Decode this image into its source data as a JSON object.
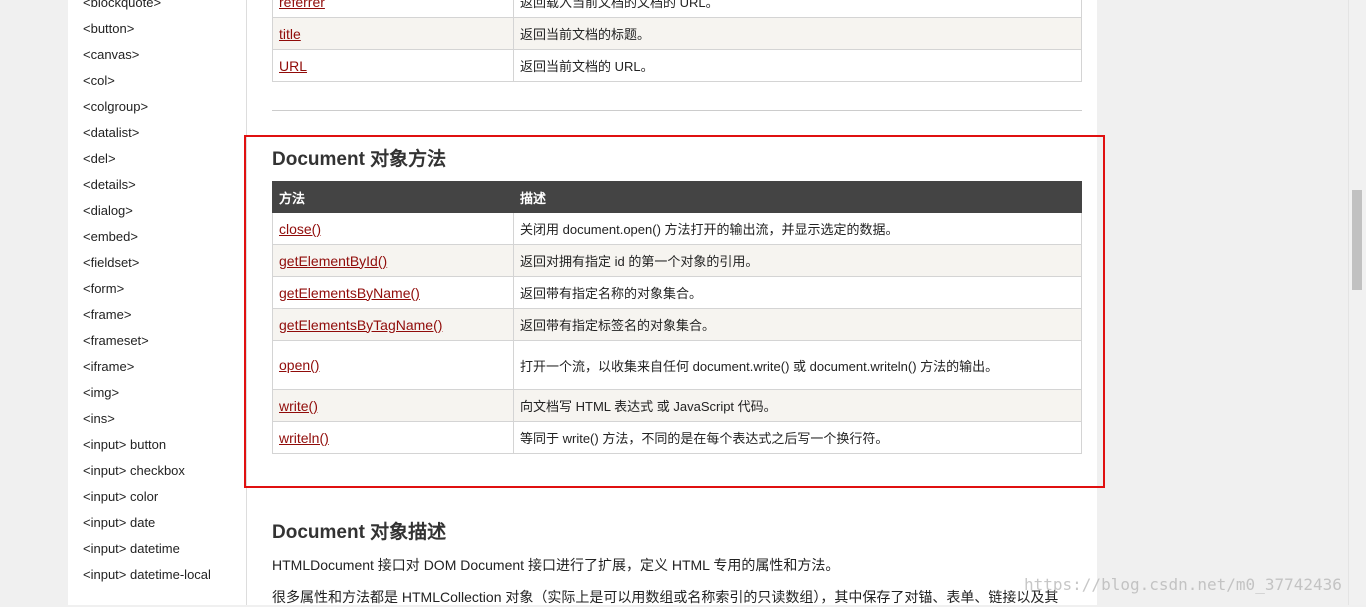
{
  "sidebar": {
    "items": [
      "<blockquote>",
      "<button>",
      "<canvas>",
      "<col>",
      "<colgroup>",
      "<datalist>",
      "<del>",
      "<details>",
      "<dialog>",
      "<embed>",
      "<fieldset>",
      "<form>",
      "<frame>",
      "<frameset>",
      "<iframe>",
      "<img>",
      "<ins>",
      "<input> button",
      "<input> checkbox",
      "<input> color",
      "<input> date",
      "<input> datetime",
      "<input> datetime-local"
    ]
  },
  "properties_table": {
    "rows": [
      {
        "name": "referrer",
        "desc": "返回载入当前文档的文档的 URL。"
      },
      {
        "name": "title",
        "desc": "返回当前文档的标题。"
      },
      {
        "name": "URL",
        "desc": "返回当前文档的 URL。"
      }
    ]
  },
  "methods_section": {
    "heading": "Document 对象方法",
    "col_method": "方法",
    "col_desc": "描述",
    "rows": [
      {
        "name": "close()",
        "desc": "关闭用 document.open() 方法打开的输出流，并显示选定的数据。"
      },
      {
        "name": "getElementById()",
        "desc": "返回对拥有指定 id 的第一个对象的引用。"
      },
      {
        "name": "getElementsByName()",
        "desc": "返回带有指定名称的对象集合。"
      },
      {
        "name": "getElementsByTagName()",
        "desc": "返回带有指定标签名的对象集合。"
      },
      {
        "name": "open()",
        "desc": "打开一个流，以收集来自任何 document.write() 或 document.writeln() 方法的输出。"
      },
      {
        "name": "write()",
        "desc": "向文档写 HTML 表达式 或 JavaScript 代码。"
      },
      {
        "name": "writeln()",
        "desc": "等同于 write() 方法，不同的是在每个表达式之后写一个换行符。"
      }
    ]
  },
  "description_section": {
    "heading": "Document 对象描述",
    "para1": "HTMLDocument 接口对 DOM Document 接口进行了扩展，定义 HTML 专用的属性和方法。",
    "para2": "很多属性和方法都是 HTMLCollection 对象（实际上是可以用数组或名称索引的只读数组），其中保存了对锚、表单、链接以及其"
  },
  "watermark": "https://blog.csdn.net/m0_37742436",
  "colors": {
    "highlight": "#e01010",
    "link": "#900b09",
    "table_header": "#444444"
  }
}
